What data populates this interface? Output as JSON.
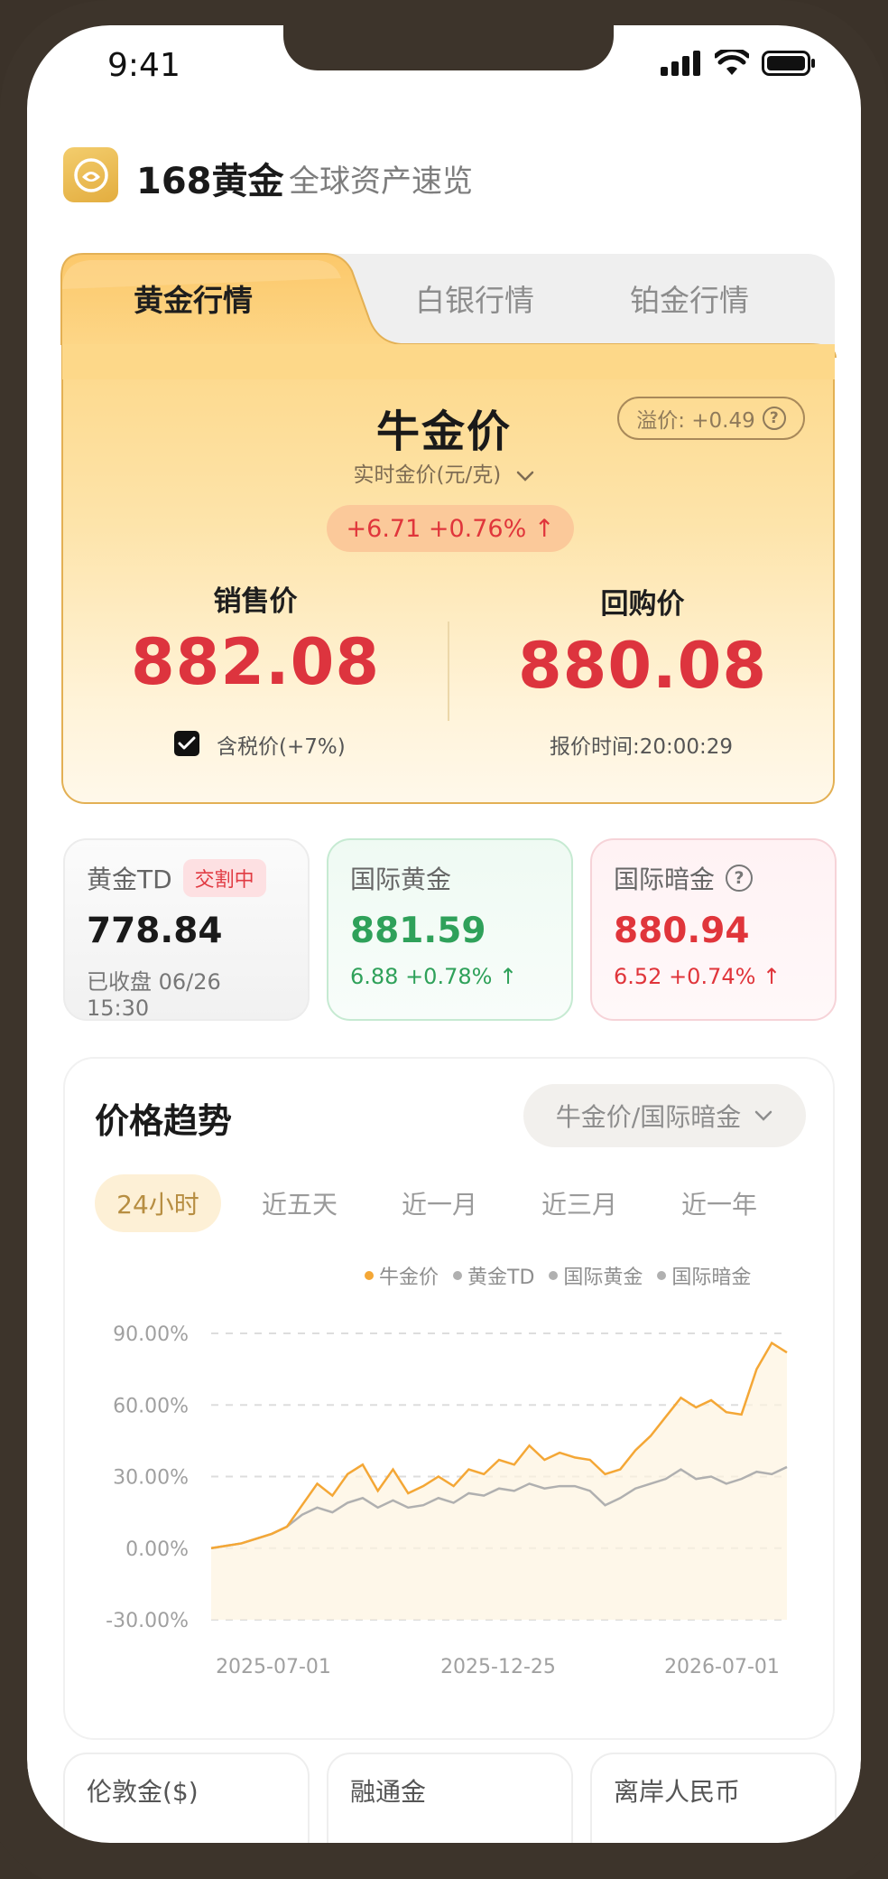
{
  "status_bar": {
    "time": "9:41"
  },
  "header": {
    "app_name": "168黄金",
    "slogan": "全球资产速览"
  },
  "tabs": [
    {
      "label": "黄金行情",
      "active": true
    },
    {
      "label": "白银行情",
      "active": false
    },
    {
      "label": "铂金行情",
      "active": false
    }
  ],
  "price_card": {
    "title": "牛金价",
    "premium": "溢价: +0.49",
    "subtitle": "实时金价(元/克)",
    "change": "+6.71 +0.76% ↑",
    "sell_label": "销售价",
    "sell_price": "882.08",
    "buy_label": "回购价",
    "buy_price": "880.08",
    "tax_label": "含税价(+7%)",
    "tax_checked": true,
    "quote_time": "报价时间:20:00:29"
  },
  "mini_cards": [
    {
      "title": "黄金TD",
      "badge": "交割中",
      "value": "778.84",
      "sub": "已收盘 06/26 15:30",
      "color": "#1a1a1a",
      "sub_color": "#777777"
    },
    {
      "title": "国际黄金",
      "value": "881.59",
      "sub": "6.88 +0.78% ↑",
      "color": "#2fa15a",
      "sub_color": "#2fa15a"
    },
    {
      "title": "国际暗金",
      "value": "880.94",
      "sub": "6.52 +0.74% ↑",
      "color": "#e0353b",
      "sub_color": "#e0353b"
    }
  ],
  "trend": {
    "title": "价格趋势",
    "selector": "牛金价/国际暗金",
    "ranges": [
      "24小时",
      "近五天",
      "近一月",
      "近三月",
      "近一年"
    ],
    "active_range": 0,
    "legend": [
      {
        "name": "牛金价",
        "color": "#f4a736"
      },
      {
        "name": "黄金TD",
        "color": "#b0b0b0"
      },
      {
        "name": "国际黄金",
        "color": "#b0b0b0"
      },
      {
        "name": "国际暗金",
        "color": "#b0b0b0"
      }
    ]
  },
  "chart_data": {
    "type": "line",
    "x_ticks": [
      "2025-07-01",
      "2025-12-25",
      "2026-07-01"
    ],
    "y_ticks": [
      "90.00%",
      "60.00%",
      "30.00%",
      "0.00%",
      "-30.00%"
    ],
    "ylim": [
      -30,
      90
    ],
    "grid": true,
    "legend_position": "top-right",
    "series": [
      {
        "name": "牛金价",
        "color": "#f4a736",
        "values": [
          0,
          1,
          2,
          4,
          6,
          9,
          18,
          27,
          22,
          31,
          35,
          24,
          33,
          23,
          26,
          30,
          26,
          33,
          31,
          37,
          35,
          43,
          37,
          40,
          38,
          37,
          31,
          33,
          41,
          47,
          55,
          63,
          59,
          62,
          57,
          56,
          75,
          86,
          82
        ]
      },
      {
        "name": "国际暗金",
        "color": "#b0b0b0",
        "values": [
          0,
          1,
          2,
          4,
          6,
          9,
          14,
          17,
          15,
          19,
          21,
          17,
          20,
          17,
          18,
          21,
          19,
          23,
          22,
          25,
          24,
          27,
          25,
          26,
          26,
          24,
          18,
          21,
          25,
          27,
          29,
          33,
          29,
          30,
          27,
          29,
          32,
          31,
          34
        ]
      }
    ]
  },
  "bottom_cards": [
    "伦敦金($)",
    "融通金",
    "离岸人民币"
  ]
}
